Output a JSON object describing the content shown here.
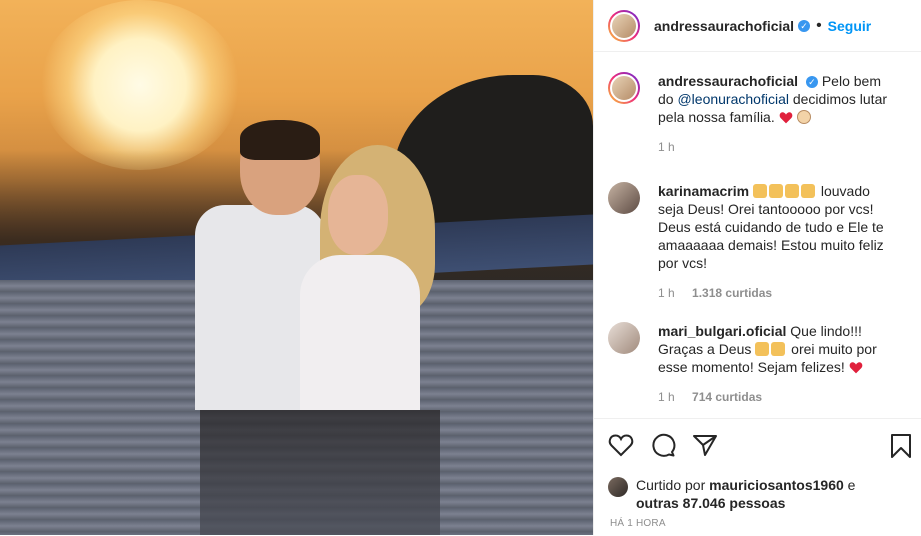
{
  "header": {
    "username": "andressaurachoficial",
    "separator": "•",
    "follow_label": "Seguir"
  },
  "caption": {
    "username": "andressaurachoficial",
    "text_before": "Pelo bem do",
    "mention": "@leonurachoficial",
    "text_after": "decidimos lutar pela nossa família.",
    "emojis": [
      "red-heart",
      "baby-face"
    ],
    "time": "1 h"
  },
  "comments": [
    {
      "username": "karinamacrim",
      "emojis": [
        "praying-hands",
        "praying-hands",
        "praying-hands",
        "praying-hands"
      ],
      "text": "louvado seja Deus! Orei tantooooo por vcs! Deus está cuidando de tudo e Ele te amaaaaaa demais! Estou muito feliz por vcs!",
      "time": "1 h",
      "likes": "1.318 curtidas"
    },
    {
      "username": "mari_bulgari.oficial",
      "text_before": "Que lindo!!! Graças a Deus",
      "emojis_mid": [
        "praying-hands",
        "praying-hands"
      ],
      "text_after": "orei muito por esse momento! Sejam felizes!",
      "emoji_end": "red-heart",
      "time": "1 h",
      "likes": "714 curtidas"
    }
  ],
  "likes": {
    "prefix": "Curtido por",
    "user": "mauriciosantos1960",
    "conj": "e",
    "others": "outras 87.046 pessoas"
  },
  "timestamp": "HÁ 1 HORA",
  "icons": [
    "heart-icon",
    "comment-icon",
    "share-icon",
    "bookmark-icon",
    "verified-badge-icon"
  ],
  "colors": {
    "accent": "#0095f6",
    "verified": "#3897f0",
    "text": "#262626",
    "muted": "#8e8e8e",
    "heart": "#ed4956"
  }
}
